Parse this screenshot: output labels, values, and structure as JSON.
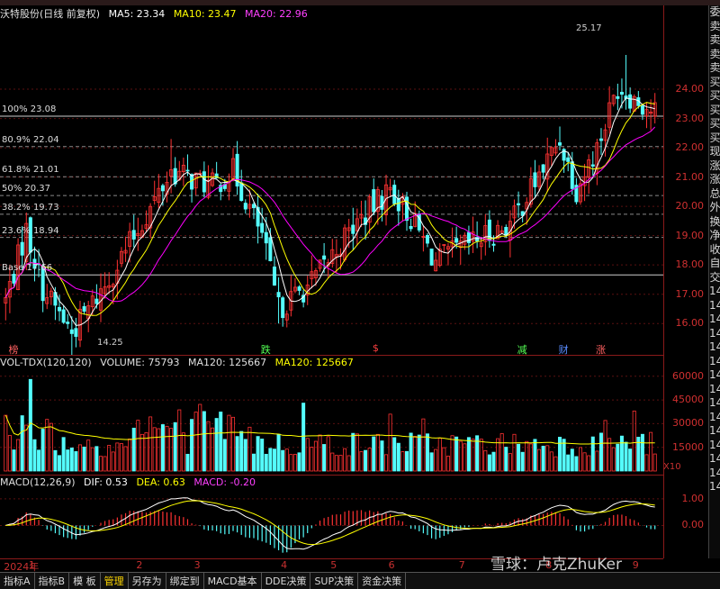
{
  "colors": {
    "up": "#ff3232",
    "down": "#54fcfc",
    "ma5": "#ffffff",
    "ma10": "#ffff00",
    "ma20": "#ff00ff",
    "vol_ma": "#ffff00",
    "dif": "#ffffff",
    "dea": "#ffff00",
    "macd_pos": "#ff3232",
    "macd_neg": "#54fcfc",
    "fib": "#aaaaaa",
    "axis": "#d03030"
  },
  "price_panel": {
    "title": "沃特股份(日线 前复权)",
    "ma5": "MA5: 23.34",
    "ma10": "MA10: 23.47",
    "ma20": "MA20: 22.96",
    "high_marker": "25.17",
    "low_marker": "14.25",
    "fib_levels": [
      {
        "label": "100% 23.08",
        "price": 23.08
      },
      {
        "label": "80.9% 22.04",
        "price": 22.04
      },
      {
        "label": "61.8% 21.01",
        "price": 21.01
      },
      {
        "label": "50% 20.37",
        "price": 20.37
      },
      {
        "label": "38.2% 19.73",
        "price": 19.73
      },
      {
        "label": "23.6% 18.94",
        "price": 18.94
      },
      {
        "label": "Base 17.66",
        "price": 17.66
      }
    ],
    "y_ticks": [
      "24.00",
      "23.00",
      "22.00",
      "21.00",
      "20.00",
      "19.00",
      "18.00",
      "17.00",
      "16.00"
    ],
    "y_tick_values": [
      24,
      23,
      22,
      21,
      20,
      19,
      18,
      17,
      16
    ],
    "events": [
      {
        "label": "榜",
        "color": "#ff6060",
        "bar": 2
      },
      {
        "label": "跌",
        "color": "#54ff54",
        "bar": 63
      },
      {
        "label": "$",
        "color": "#ff4040",
        "bar": 90
      },
      {
        "label": "减",
        "color": "#54ff54",
        "bar": 125
      },
      {
        "label": "财",
        "color": "#5a8cff",
        "bar": 135
      },
      {
        "label": "涨",
        "color": "#ff6060",
        "bar": 144
      }
    ]
  },
  "volume_panel": {
    "title": "VOL-TDX(120,120)",
    "volume": "VOLUME: 75793",
    "ma120a": "MA120: 125667",
    "ma120b": "MA120: 125667",
    "y_ticks": [
      "60000",
      "45000",
      "30000",
      "15000"
    ],
    "y_tick_values": [
      60000,
      45000,
      30000,
      15000
    ],
    "unit": "X10"
  },
  "macd_panel": {
    "title": "MACD(12,26,9)",
    "dif": "DIF: 0.53",
    "dea": "DEA: 0.63",
    "macd": "MACD: -0.20",
    "y_ticks": [
      "1.00",
      "0.00"
    ],
    "y_tick_values": [
      1,
      0
    ]
  },
  "x_axis": {
    "labels": [
      {
        "text": "2024年",
        "bar": 0
      },
      {
        "text": "1",
        "bar": 6
      },
      {
        "text": "2",
        "bar": 32
      },
      {
        "text": "3",
        "bar": 46
      },
      {
        "text": "4",
        "bar": 67
      },
      {
        "text": "5",
        "bar": 79
      },
      {
        "text": "6",
        "bar": 93
      },
      {
        "text": "7",
        "bar": 110
      },
      {
        "text": "8",
        "bar": 131
      },
      {
        "text": "9",
        "bar": 152
      }
    ]
  },
  "right_column": [
    "委",
    "卖",
    "卖",
    "卖",
    "卖",
    "买",
    "买",
    "买",
    "买",
    "买",
    "现",
    "涨",
    "涨",
    "总",
    "外",
    "换",
    "净",
    "收",
    "自",
    "交",
    "14",
    "14",
    "14",
    "14",
    "14",
    "14",
    "14",
    "14",
    "14",
    "14",
    "14",
    "14",
    "14",
    "14",
    "14"
  ],
  "tabs": [
    {
      "label": "指标A",
      "active": false
    },
    {
      "label": "指标B",
      "active": false
    },
    {
      "label": "模 板",
      "active": false
    },
    {
      "label": "管理",
      "active": true
    },
    {
      "label": "另存为",
      "active": false
    },
    {
      "label": "绑定到",
      "active": false
    },
    {
      "label": "MACD基本",
      "active": false
    },
    {
      "label": "DDE决策",
      "active": false
    },
    {
      "label": "SUP决策",
      "active": false
    },
    {
      "label": "资金决策",
      "active": false
    }
  ],
  "watermark": "雪球：卢克ZhuKer",
  "chart_data": {
    "type": "candlestick",
    "title": "沃特股份(日线 前复权)",
    "ylim": [
      15.3,
      26.0
    ],
    "approx_close_path": [
      {
        "bar": 0,
        "close": 16.8
      },
      {
        "bar": 5,
        "close": 19.2
      },
      {
        "bar": 9,
        "close": 17.2
      },
      {
        "bar": 16,
        "close": 15.7
      },
      {
        "bar": 24,
        "close": 17.3
      },
      {
        "bar": 34,
        "close": 19.7
      },
      {
        "bar": 40,
        "close": 21.2
      },
      {
        "bar": 50,
        "close": 20.7
      },
      {
        "bar": 55,
        "close": 21.2
      },
      {
        "bar": 62,
        "close": 19.0
      },
      {
        "bar": 66,
        "close": 16.5
      },
      {
        "bar": 74,
        "close": 17.4
      },
      {
        "bar": 84,
        "close": 19.3
      },
      {
        "bar": 93,
        "close": 20.6
      },
      {
        "bar": 98,
        "close": 19.6
      },
      {
        "bar": 104,
        "close": 18.1
      },
      {
        "bar": 112,
        "close": 18.7
      },
      {
        "bar": 122,
        "close": 19.4
      },
      {
        "bar": 130,
        "close": 21.3
      },
      {
        "bar": 134,
        "close": 22.3
      },
      {
        "bar": 138,
        "close": 20.6
      },
      {
        "bar": 143,
        "close": 22.0
      },
      {
        "bar": 148,
        "close": 24.1
      },
      {
        "bar": 152,
        "close": 23.7
      },
      {
        "bar": 156,
        "close": 23.3
      }
    ],
    "volume_ma120": 125667,
    "macd": {
      "dif": 0.53,
      "dea": 0.63,
      "macd": -0.2
    }
  }
}
